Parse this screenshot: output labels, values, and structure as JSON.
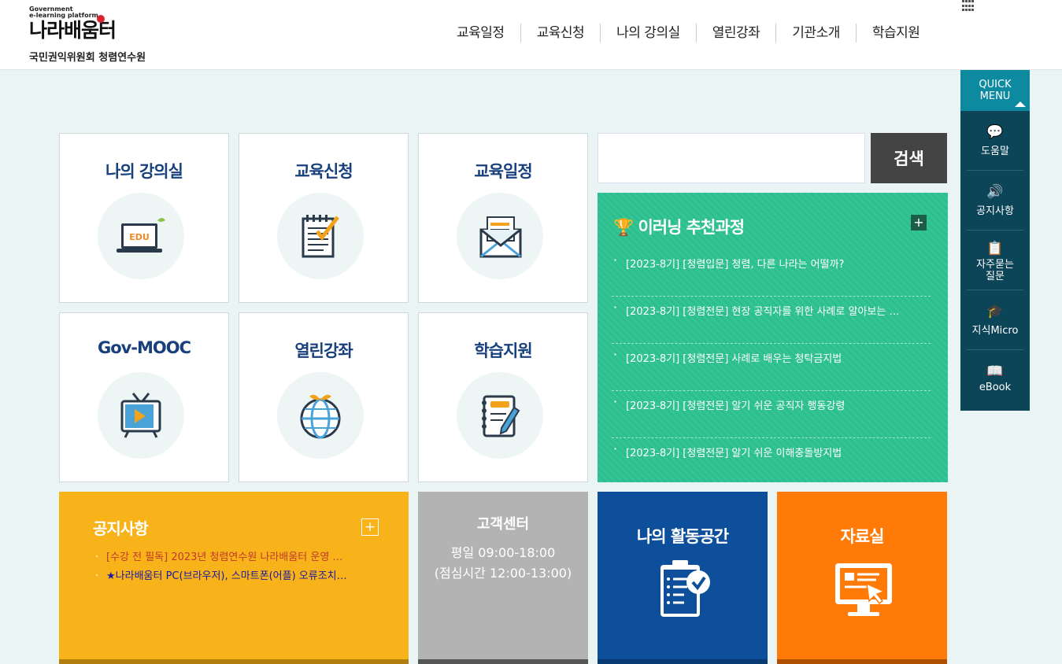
{
  "header": {
    "logo_small_line1": "Government",
    "logo_small_line2": "e-learning platform",
    "logo_name": "나라배움터",
    "org_name": "국민권익위원회 청렴연수원",
    "nav": [
      "교육일정",
      "교육신청",
      "나의 강의실",
      "열린강좌",
      "기관소개",
      "학습지원"
    ]
  },
  "tiles": [
    {
      "title": "나의 강의실",
      "icon": "edu-laptop-icon",
      "icon_text": "EDU"
    },
    {
      "title": "교육신청",
      "icon": "notepad-check-icon"
    },
    {
      "title": "교육일정",
      "icon": "envelope-icon"
    },
    {
      "title": "Gov-MOOC",
      "icon": "tv-play-icon"
    },
    {
      "title": "열린강좌",
      "icon": "globe-icon"
    },
    {
      "title": "학습지원",
      "icon": "notebook-pencil-icon"
    }
  ],
  "search": {
    "placeholder": "",
    "button_label": "검색"
  },
  "recommend": {
    "title": "이러닝 추천과정",
    "icon": "trophy-icon",
    "items": [
      "[2023-8기] [청렴입문] 청렴, 다른 나라는 어떨까?",
      "[2023-8기] [청렴전문] 현장 공직자를 위한 사례로 알아보는 …",
      "[2023-8기] [청렴전문] 사례로 배우는 청탁금지법",
      "[2023-8기] [청렴전문] 알기 쉬운 공직자 행동강령",
      "[2023-8기] [청렴전문] 알기 쉬운 이해충돌방지법"
    ]
  },
  "quick_menu": {
    "title_line1": "QUICK",
    "title_line2": "MENU",
    "items": [
      {
        "label": "도움말",
        "icon": "chat-icon"
      },
      {
        "label": "공지사항",
        "icon": "speaker-icon"
      },
      {
        "label": "자주묻는 질문",
        "icon": "faq-icon"
      },
      {
        "label": "지식Micro",
        "icon": "graduation-cap-icon"
      },
      {
        "label": "eBook",
        "icon": "ebook-icon"
      }
    ]
  },
  "notice": {
    "title": "공지사항",
    "items": [
      "[수강 전 필독] 2023년 청렴연수원 나라배움터 운영 …",
      "★나라배움터 PC(브라우저), 스마트폰(어플) 오류조치…"
    ]
  },
  "customer_center": {
    "title": "고객센터",
    "hours": "평일 09:00-18:00",
    "lunch": "(점심시간 12:00-13:00)"
  },
  "activity": {
    "title": "나의 활동공간",
    "icon": "clipboard-check-icon"
  },
  "library": {
    "title": "자료실",
    "icon": "monitor-cursor-icon"
  }
}
